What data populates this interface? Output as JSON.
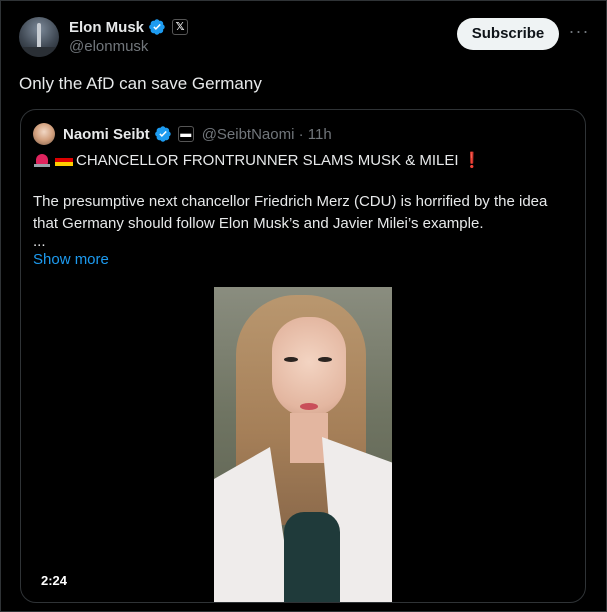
{
  "post": {
    "author": {
      "display_name": "Elon Musk",
      "handle": "@elonmusk",
      "affiliation_badge": "𝕏"
    },
    "subscribe_label": "Subscribe",
    "more_label": "···",
    "text": "Only the AfD can save Germany"
  },
  "quote": {
    "author": {
      "display_name": "Naomi Seibt",
      "handle": "@SeibtNaomi · 11h"
    },
    "headline": "CHANCELLOR FRONTRUNNER SLAMS MUSK & MILEI",
    "headline_suffix": "❗",
    "body": "The presumptive next chancellor Friedrich Merz (CDU) is horrified by the idea that Germany should follow Elon Musk’s and Javier Milei’s example.",
    "ellipsis": "...",
    "show_more_label": "Show more",
    "video": {
      "duration": "2:24"
    }
  },
  "colors": {
    "background": "#000000",
    "text": "#e7e9ea",
    "muted": "#71767b",
    "link": "#1d9bf0",
    "verified": "#1d9bf0",
    "border": "#2f3336"
  },
  "icons": [
    "verified-badge-icon",
    "x-affiliation-icon",
    "more-icon",
    "siren-emoji-icon",
    "germany-flag-icon"
  ]
}
